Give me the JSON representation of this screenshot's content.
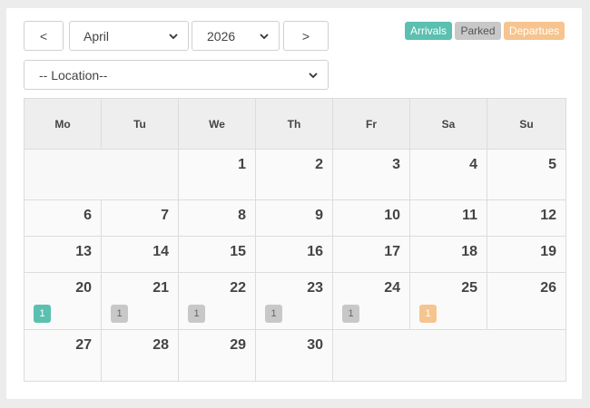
{
  "toolbar": {
    "prev_label": "<",
    "next_label": ">",
    "month_value": "April",
    "year_value": "2026",
    "location_value": "-- Location--"
  },
  "legend": {
    "arrivals": "Arrivals",
    "parked": "Parked",
    "departures": "Departues"
  },
  "colors": {
    "arrivals": "#5bc0b0",
    "parked": "#c8c8c8",
    "departures": "#f6c48f"
  },
  "calendar": {
    "weekdays": [
      "Mo",
      "Tu",
      "We",
      "Th",
      "Fr",
      "Sa",
      "Su"
    ],
    "weeks": [
      [
        null,
        null,
        {
          "day": "1"
        },
        {
          "day": "2"
        },
        {
          "day": "3"
        },
        {
          "day": "4"
        },
        {
          "day": "5"
        }
      ],
      [
        {
          "day": "6"
        },
        {
          "day": "7"
        },
        {
          "day": "8"
        },
        {
          "day": "9"
        },
        {
          "day": "10"
        },
        {
          "day": "11"
        },
        {
          "day": "12"
        }
      ],
      [
        {
          "day": "13"
        },
        {
          "day": "14"
        },
        {
          "day": "15"
        },
        {
          "day": "16"
        },
        {
          "day": "17"
        },
        {
          "day": "18"
        },
        {
          "day": "19"
        }
      ],
      [
        {
          "day": "20",
          "badge": {
            "type": "arrivals",
            "count": "1"
          }
        },
        {
          "day": "21",
          "badge": {
            "type": "parked",
            "count": "1"
          }
        },
        {
          "day": "22",
          "badge": {
            "type": "parked",
            "count": "1"
          }
        },
        {
          "day": "23",
          "badge": {
            "type": "parked",
            "count": "1"
          }
        },
        {
          "day": "24",
          "badge": {
            "type": "parked",
            "count": "1"
          }
        },
        {
          "day": "25",
          "badge": {
            "type": "departures",
            "count": "1"
          }
        },
        {
          "day": "26"
        }
      ],
      [
        {
          "day": "27"
        },
        {
          "day": "28"
        },
        {
          "day": "29"
        },
        {
          "day": "30"
        },
        null,
        null,
        null
      ]
    ]
  }
}
